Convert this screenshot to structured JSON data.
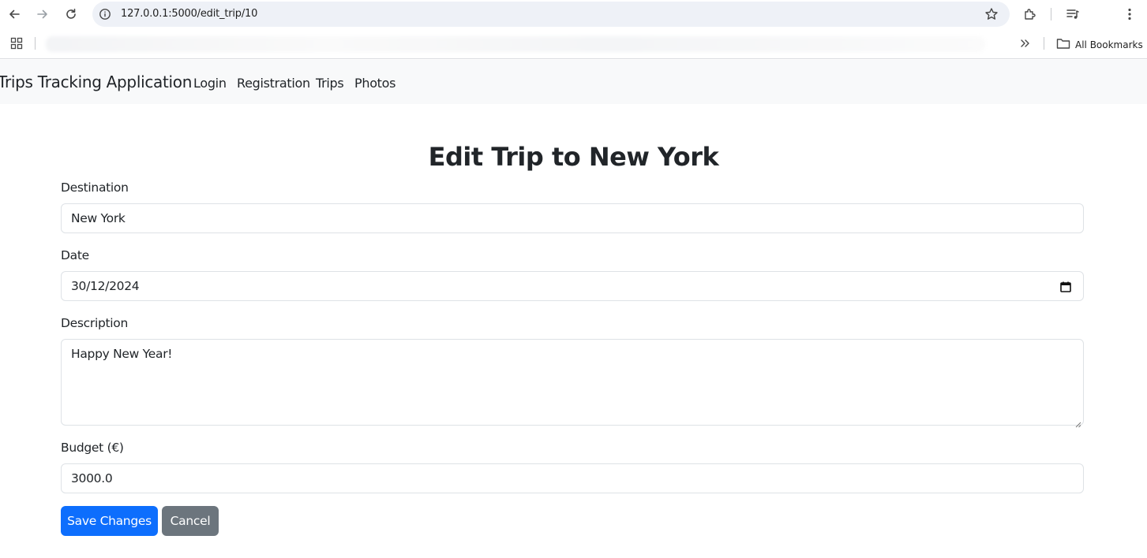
{
  "browser": {
    "url": "127.0.0.1:5000/edit_trip/10",
    "bookmarks_label": "All Bookmarks",
    "icons": [
      "back-arrow-icon",
      "forward-arrow-icon",
      "reload-icon",
      "site-info-icon",
      "star-icon",
      "extensions-icon",
      "media-icon",
      "menu-icon",
      "apps-grid-icon",
      "chevron-double-right-icon",
      "folder-icon"
    ]
  },
  "navbar": {
    "brand": "Trips Tracking Application",
    "links": [
      "Login",
      "Registration",
      "Trips",
      "Photos"
    ]
  },
  "form": {
    "title": "Edit Trip to New York",
    "destination_label": "Destination",
    "destination_value": "New York",
    "date_label": "Date",
    "date_value": "30/12/2024",
    "description_label": "Description",
    "description_value": "Happy New Year!",
    "budget_label": "Budget (€)",
    "budget_value": "3000.0",
    "save_label": "Save Changes",
    "cancel_label": "Cancel"
  },
  "colors": {
    "primary": "#0d6efd",
    "secondary": "#6c757d",
    "navbar_bg": "#f8f9fa",
    "text": "#212529",
    "border": "#dee2e6"
  }
}
